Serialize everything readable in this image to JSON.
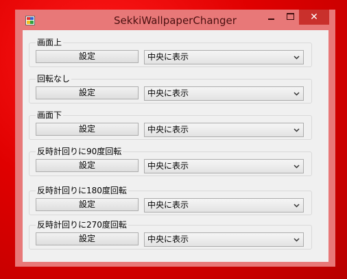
{
  "window": {
    "title": "SekkiWallpaperChanger",
    "close_glyph": "✕"
  },
  "groups": [
    {
      "label": "画面上",
      "button": "設定",
      "mode": "中央に表示"
    },
    {
      "label": "回転なし",
      "button": "設定",
      "mode": "中央に表示"
    },
    {
      "label": "画面下",
      "button": "設定",
      "mode": "中央に表示"
    },
    {
      "label": "反時計回りに90度回転",
      "button": "設定",
      "mode": "中央に表示"
    },
    {
      "label": "反時計回りに180度回転",
      "button": "設定",
      "mode": "中央に表示"
    },
    {
      "label": "反時計回りに270度回転",
      "button": "設定",
      "mode": "中央に表示"
    }
  ],
  "icons": {
    "app": "app-icon",
    "dropdown": "chevron-down-icon"
  },
  "colors": {
    "desktop": "#e00000",
    "window_frame": "#e87878",
    "close_button": "#c9302c",
    "client": "#f0f0f0"
  }
}
